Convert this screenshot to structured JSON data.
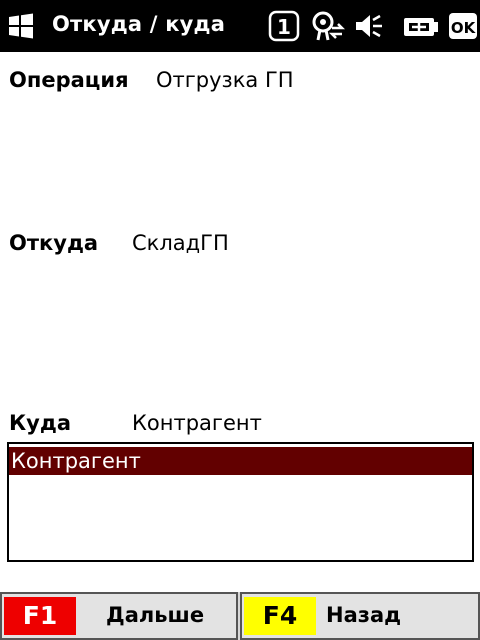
{
  "titlebar": {
    "title": "Откуда / куда",
    "icons": [
      "windows-logo-icon",
      "notification-one-icon",
      "connectivity-icon",
      "volume-muted-icon",
      "battery-charging-icon",
      "ok-icon"
    ],
    "ok_label": "OK",
    "notification_count": "1"
  },
  "fields": {
    "operation": {
      "label": "Операция",
      "value": "Отгрузка ГП"
    },
    "from": {
      "label": "Откуда",
      "value": "СкладГП"
    },
    "to": {
      "label": "Куда",
      "value": "Контрагент"
    }
  },
  "listbox": {
    "items": [
      {
        "label": "Контрагент",
        "selected": true
      }
    ]
  },
  "buttons": [
    {
      "key": "F1",
      "label": "Дальше",
      "key_color": "#ee0000"
    },
    {
      "key": "F4",
      "label": "Назад",
      "key_color": "#ffff00"
    }
  ],
  "colors": {
    "titlebar_bg": "#000000",
    "selection_bg": "#620000",
    "f1_key": "#ee0000",
    "f4_key": "#ffff00"
  }
}
